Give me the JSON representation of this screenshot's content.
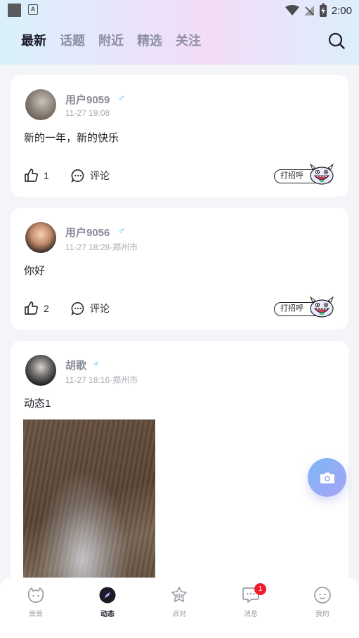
{
  "status_bar": {
    "time": "2:00",
    "notification_letter": "A"
  },
  "tabs": [
    {
      "label": "最新",
      "active": true
    },
    {
      "label": "话题",
      "active": false
    },
    {
      "label": "附近",
      "active": false
    },
    {
      "label": "精选",
      "active": false
    },
    {
      "label": "关注",
      "active": false
    }
  ],
  "posts": [
    {
      "username": "用户9059",
      "gender": "♂",
      "meta": "11-27 19:08",
      "content": "新的一年，新的快乐",
      "likes": "1",
      "comment_label": "评论",
      "greet_label": "打招呼"
    },
    {
      "username": "用户9056",
      "gender": "♂",
      "meta": "11-27 18:28·郑州市",
      "content": "你好",
      "likes": "2",
      "comment_label": "评论",
      "greet_label": "打招呼"
    },
    {
      "username": "胡歌",
      "gender": "♂",
      "meta": "11-27 18:16·郑州市",
      "content": "动态1"
    }
  ],
  "bottom_nav": [
    {
      "label": "兽兽",
      "icon": "beast-icon",
      "active": false
    },
    {
      "label": "动态",
      "icon": "compass-icon",
      "active": true
    },
    {
      "label": "派对",
      "icon": "party-icon",
      "active": false
    },
    {
      "label": "消息",
      "icon": "message-icon",
      "active": false,
      "badge": "1"
    },
    {
      "label": "我的",
      "icon": "profile-icon",
      "active": false
    }
  ],
  "colors": {
    "accent_blue": "#35b8f0",
    "badge_red": "#f21d2b",
    "fab_gradient_start": "#7db7f6",
    "fab_gradient_end": "#a6a3f4"
  }
}
